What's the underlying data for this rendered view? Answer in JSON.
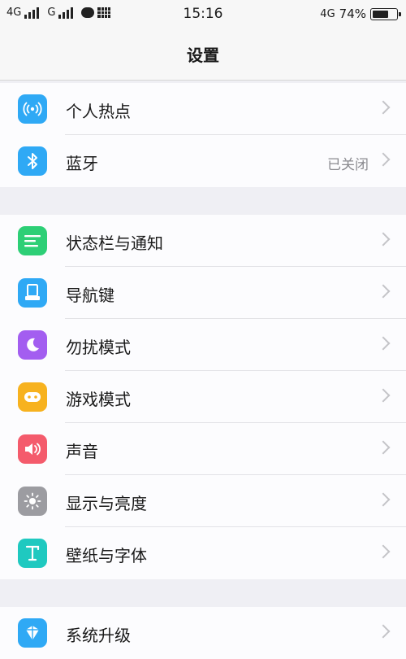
{
  "status_bar": {
    "network1": "4G",
    "network2": "G",
    "time": "15:16",
    "network3": "4G",
    "battery_percent": "74%",
    "battery_level": 0.74,
    "icons": [
      "signal-icon",
      "signal-icon",
      "chat-icon",
      "grid-icon",
      "battery-icon"
    ]
  },
  "nav": {
    "title": "设置"
  },
  "colors": {
    "hotspot": "#2fa9f5",
    "bluetooth": "#2fa9f5",
    "status": "#2dcf76",
    "navkeys": "#2fa9f5",
    "dnd": "#a35ef0",
    "game": "#f7b21f",
    "sound": "#f45b6c",
    "display": "#9c9ca1",
    "wallpaper": "#1fc9c0",
    "update": "#2fa9f5"
  },
  "groups": [
    {
      "items": [
        {
          "label": "个人热点",
          "icon": "hotspot-icon"
        },
        {
          "label": "蓝牙",
          "value": "已关闭",
          "icon": "bluetooth-icon"
        }
      ]
    },
    {
      "items": [
        {
          "label": "状态栏与通知",
          "icon": "status-bar-icon"
        },
        {
          "label": "导航键",
          "icon": "nav-keys-icon"
        },
        {
          "label": "勿扰模式",
          "icon": "moon-icon"
        },
        {
          "label": "游戏模式",
          "icon": "gamepad-icon"
        },
        {
          "label": "声音",
          "icon": "speaker-icon"
        },
        {
          "label": "显示与亮度",
          "icon": "sun-icon"
        },
        {
          "label": "壁纸与字体",
          "icon": "font-icon"
        }
      ]
    },
    {
      "items": [
        {
          "label": "系统升级",
          "icon": "update-icon"
        }
      ]
    }
  ]
}
